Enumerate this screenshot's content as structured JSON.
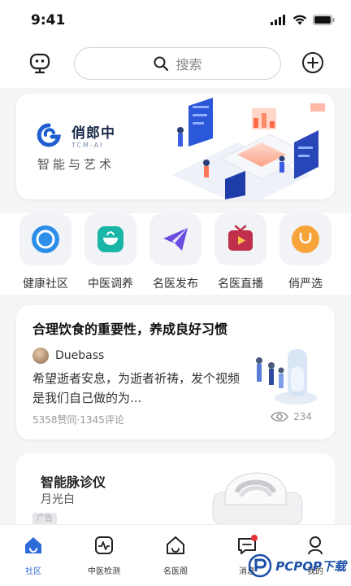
{
  "status_bar": {
    "time": "9:41"
  },
  "header": {
    "search_placeholder": "搜索"
  },
  "banner": {
    "brand_name": "俏郎中",
    "brand_sub": "TCM-AI",
    "tagline": "智能与艺术"
  },
  "categories": [
    {
      "label": "健康社区",
      "color": "#2c8ee8"
    },
    {
      "label": "中医调养",
      "color": "#19b6a7"
    },
    {
      "label": "名医发布",
      "color": "#6a4de0"
    },
    {
      "label": "名医直播",
      "color": "#c0304a"
    },
    {
      "label": "俏严选",
      "color": "#f7a43a"
    }
  ],
  "article": {
    "title": "合理饮食的重要性，养成良好习惯",
    "author": "Duebass",
    "description": "希望逝者安息，为逝者祈祷，发个视频是我们自己做的为...",
    "stats": "5358赞同·1345评论",
    "views": "234"
  },
  "ad": {
    "name": "智能脉诊仪",
    "variant": "月光白",
    "badge": "广告"
  },
  "tabs": [
    {
      "label": "社区",
      "active": true
    },
    {
      "label": "中医检测"
    },
    {
      "label": "名医阁"
    },
    {
      "label": "消息"
    },
    {
      "label": "我的"
    }
  ],
  "watermark": {
    "text": "PCPOP下载"
  },
  "colors": {
    "accent": "#2f6bd8",
    "text": "#222222",
    "muted": "#999999"
  }
}
